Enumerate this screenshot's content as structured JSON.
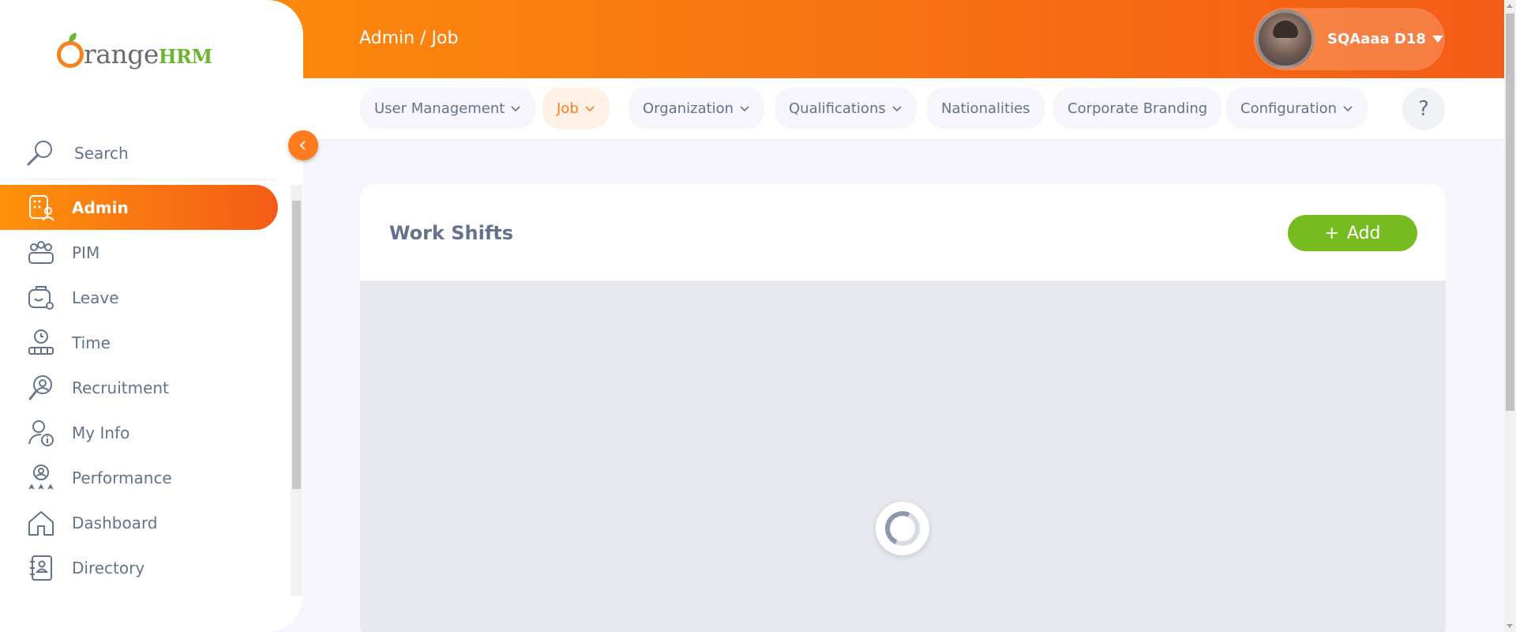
{
  "brand": {
    "logo_text": "range",
    "logo_suffix": "HRM",
    "accent": "#ff7b1d",
    "green": "#76bc21"
  },
  "header": {
    "breadcrumb": "Admin / Job",
    "user_name": "SQAaaa D18"
  },
  "sidebar": {
    "search_label": "Search",
    "items": [
      {
        "label": "Admin",
        "icon": "admin-icon",
        "active": true
      },
      {
        "label": "PIM",
        "icon": "pim-icon"
      },
      {
        "label": "Leave",
        "icon": "leave-icon"
      },
      {
        "label": "Time",
        "icon": "time-icon"
      },
      {
        "label": "Recruitment",
        "icon": "recruitment-icon"
      },
      {
        "label": "My Info",
        "icon": "my-info-icon"
      },
      {
        "label": "Performance",
        "icon": "performance-icon"
      },
      {
        "label": "Dashboard",
        "icon": "dashboard-icon"
      },
      {
        "label": "Directory",
        "icon": "directory-icon"
      }
    ]
  },
  "topnav": {
    "tabs": [
      {
        "label": "User Management",
        "has_dropdown": true
      },
      {
        "label": "Job",
        "has_dropdown": true,
        "active": true
      },
      {
        "label": "Organization",
        "has_dropdown": true
      },
      {
        "label": "Qualifications",
        "has_dropdown": true
      },
      {
        "label": "Nationalities",
        "has_dropdown": false
      },
      {
        "label": "Corporate Branding",
        "has_dropdown": false
      },
      {
        "label": "Configuration",
        "has_dropdown": true
      }
    ],
    "help_label": "?"
  },
  "main": {
    "title": "Work Shifts",
    "add_label": "Add",
    "add_icon": "+"
  }
}
